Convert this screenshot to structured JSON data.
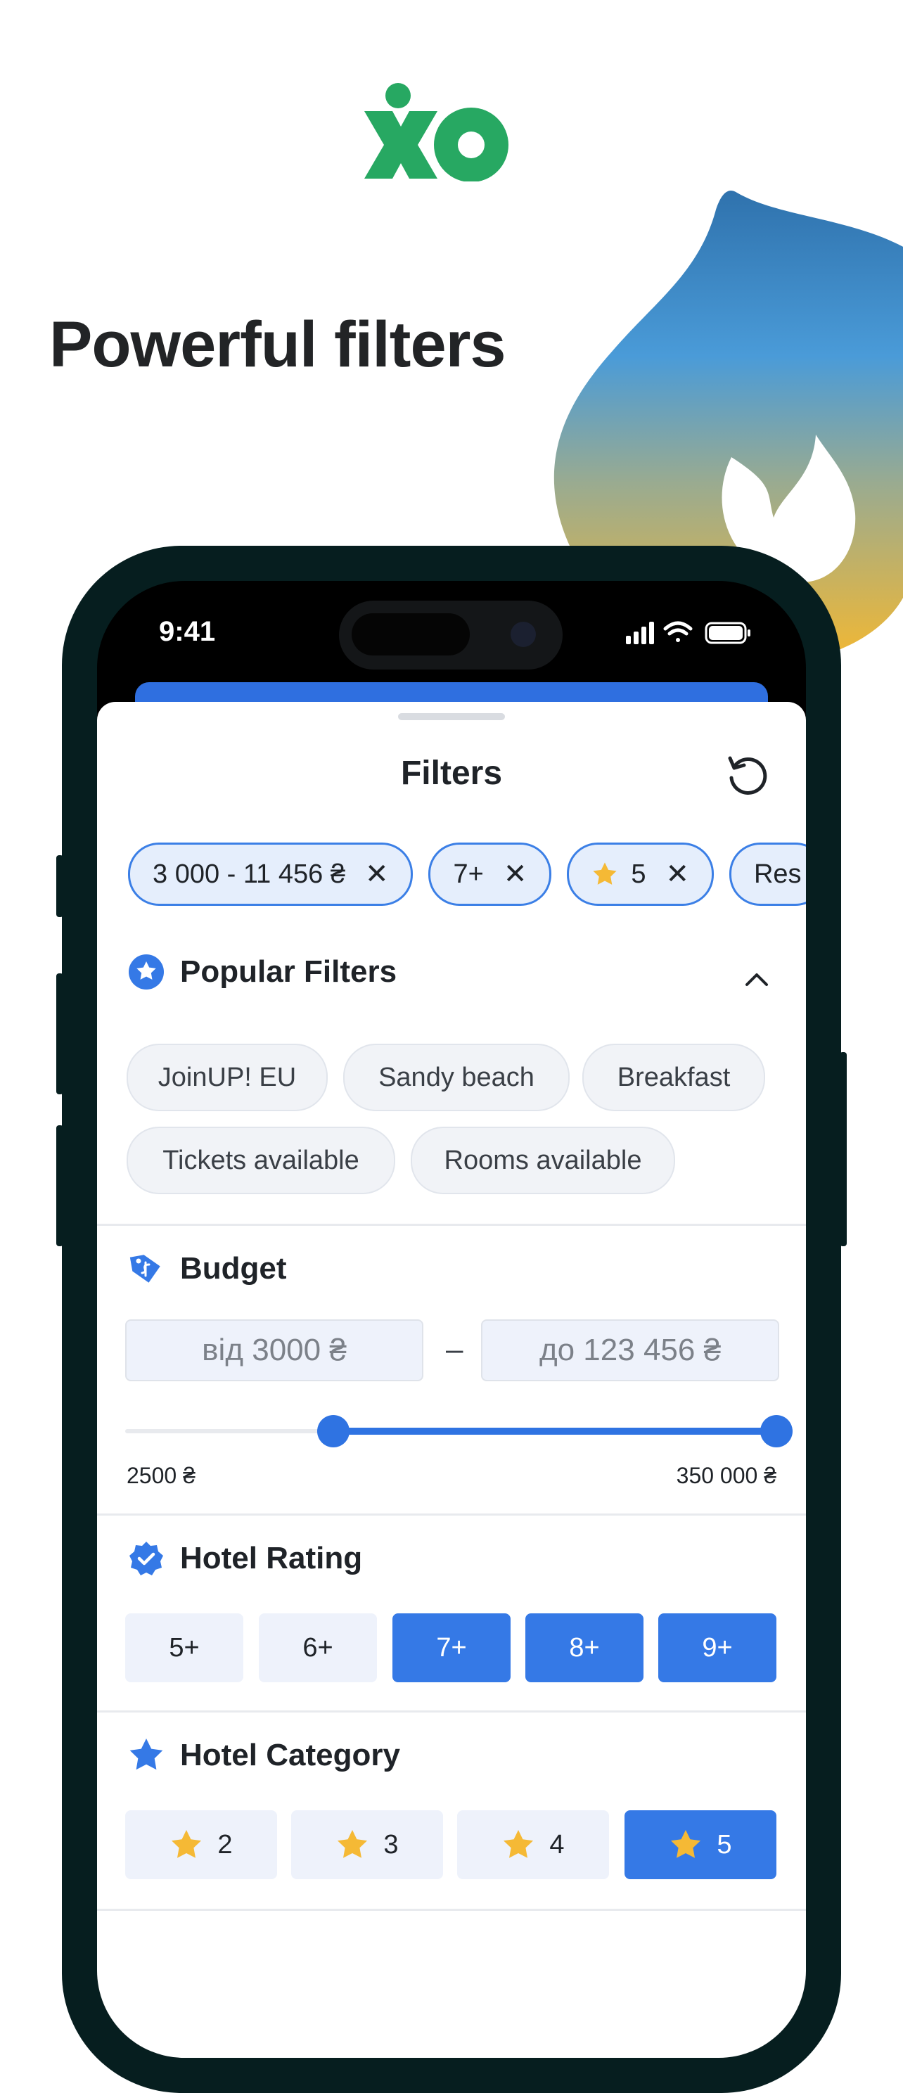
{
  "headline": "Powerful filters",
  "status_bar": {
    "time": "9:41"
  },
  "sheet": {
    "title": "Filters",
    "active_chips": [
      {
        "label": "3 000 - 11 456 ₴",
        "star": false
      },
      {
        "label": "7+",
        "star": false
      },
      {
        "label": "5",
        "star": true
      },
      {
        "label": "Res",
        "star": false
      }
    ],
    "popular": {
      "title": "Popular Filters",
      "tags": [
        "JoinUP! EU",
        "Sandy beach",
        "Breakfast",
        "Tickets available",
        "Rooms available"
      ]
    },
    "budget": {
      "title": "Budget",
      "from_placeholder": "від 3000 ₴",
      "separator": "–",
      "to_placeholder": "до 123 456 ₴",
      "min_label": "2500 ₴",
      "max_label": "350 000 ₴",
      "slider_low_fraction": 0.32,
      "slider_high_fraction": 1.0
    },
    "rating": {
      "title": "Hotel Rating",
      "options": [
        "5+",
        "6+",
        "7+",
        "8+",
        "9+"
      ],
      "selected": [
        "7+",
        "8+",
        "9+"
      ]
    },
    "category": {
      "title": "Hotel Category",
      "options": [
        "2",
        "3",
        "4",
        "5"
      ],
      "selected": [
        "5"
      ]
    }
  },
  "colors": {
    "brand_green": "#27a862",
    "accent_blue": "#3579e6",
    "star_yellow": "#f5b935",
    "phone_frame": "#061e1f"
  },
  "icons": [
    "brand-logo",
    "flame-graphic",
    "reset-icon",
    "close-icon",
    "star-icon",
    "chevron-up-icon",
    "tag-icon",
    "verified-badge-icon",
    "signal-icon",
    "wifi-icon",
    "battery-icon"
  ]
}
